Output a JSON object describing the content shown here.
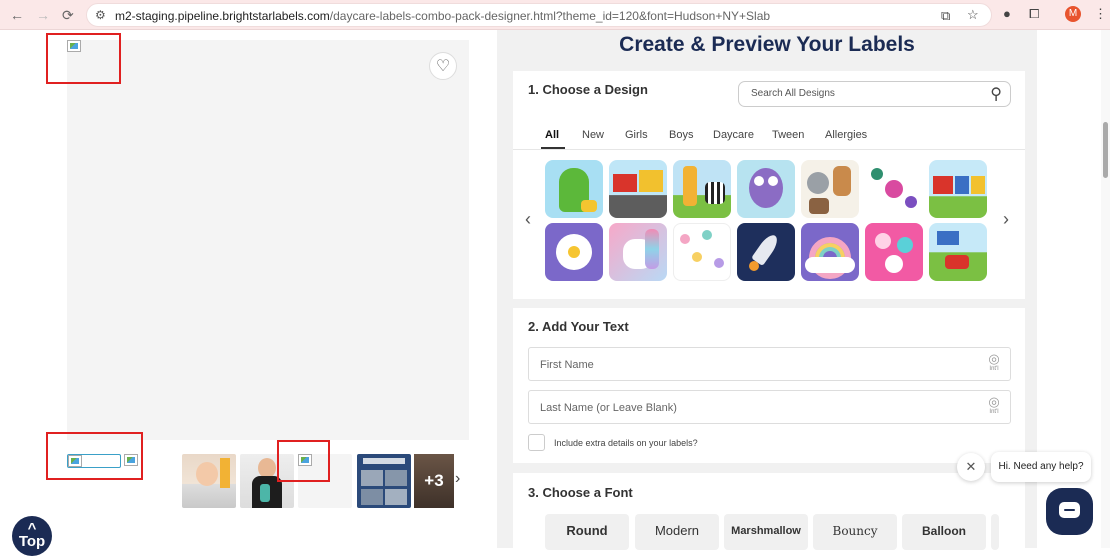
{
  "browser": {
    "back": "←",
    "forward": "→",
    "reload": "⟳",
    "url_host": "m2-staging.pipeline.brightstarlabels.com",
    "url_path": "/daycare-labels-combo-pack-designer.html?theme_id=120&font=Hudson+NY+Slab",
    "profile_initial": "M"
  },
  "gallery": {
    "more_count": "+3",
    "top_label": "Top"
  },
  "page": {
    "title": "Create & Preview Your Labels"
  },
  "design": {
    "title": "1. Choose a Design",
    "search_placeholder": "Search All Designs",
    "tabs": [
      "All",
      "New",
      "Girls",
      "Boys",
      "Daycare",
      "Tween",
      "Allergies"
    ],
    "active_tab": "All",
    "row1_icons": [
      "dinosaur-design",
      "trucks-design",
      "giraffe-zebra-design",
      "owl-design",
      "koala-animals-design",
      "floral-design",
      "train-design"
    ],
    "row2_icons": [
      "daisy-design",
      "unicorn-design",
      "pastel-flowers-design",
      "rocket-design",
      "rainbow-design",
      "hearts-design",
      "vehicles-design"
    ]
  },
  "text": {
    "title": "2. Add Your Text",
    "first_name_placeholder": "First Name",
    "last_name_placeholder": "Last Name (or Leave Blank)",
    "intl_label": "Int'l",
    "extra_details_label": "Include extra details on your labels?"
  },
  "font": {
    "title": "3. Choose a Font",
    "options": [
      "Round",
      "Modern",
      "Marshmallow",
      "Bouncy",
      "Balloon"
    ]
  },
  "chat": {
    "message": "Hi. Need any help?"
  },
  "colors": {
    "navy": "#1b2b54",
    "annotation_red": "#e02020"
  }
}
